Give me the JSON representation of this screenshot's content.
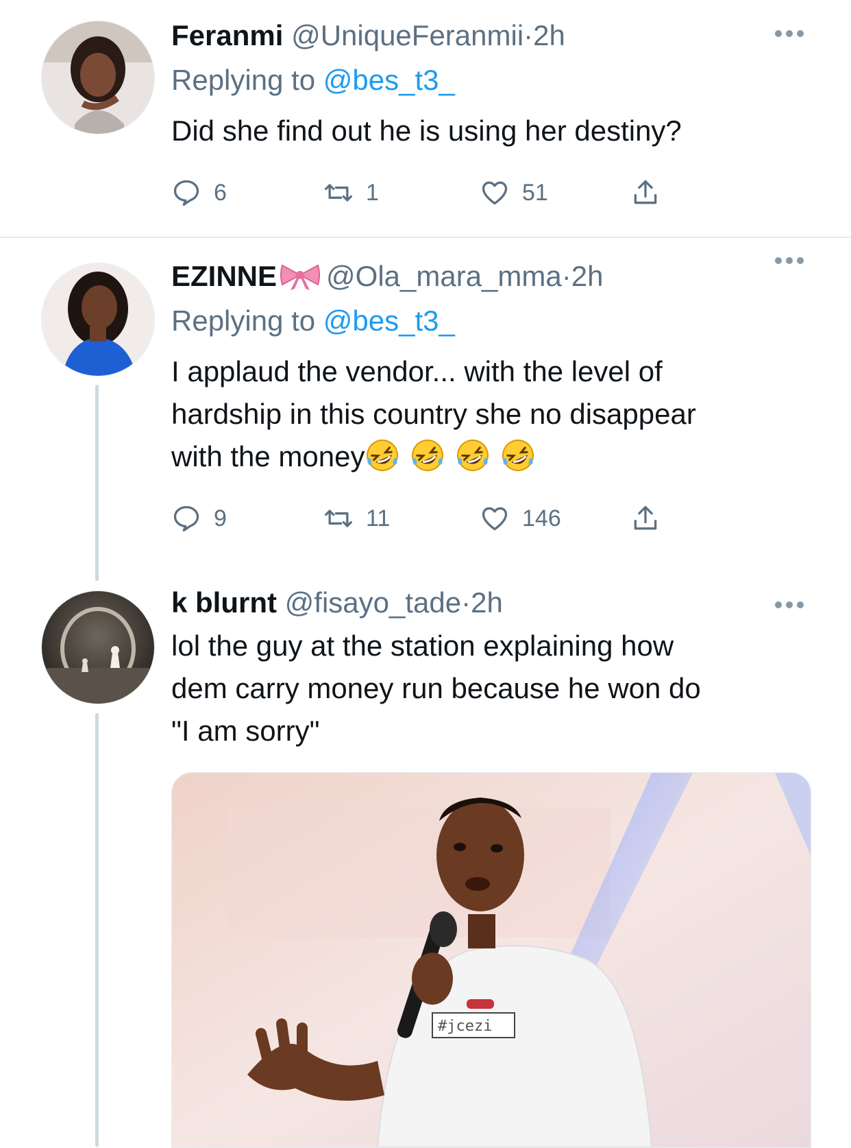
{
  "colors": {
    "link": "#1d9bf0",
    "secondary_text": "#5b7083",
    "primary_text": "#0f1419",
    "divider": "#e6ecf0",
    "thread_line": "#cfd9de"
  },
  "icons": {
    "reply": "speech-bubble",
    "retweet": "retweet-arrows",
    "like": "heart-outline",
    "share": "share-up-arrow",
    "more": "three-dots",
    "bow": "pink-ribbon-emoji",
    "laugh": "rolling-on-floor-laughing-emoji"
  },
  "tweets": [
    {
      "name": "Feranmi",
      "handle": "@UniqueFeranmii",
      "separator": "·",
      "time": "2h",
      "replying_prefix": "Replying to",
      "replying_to": "@bes_t3_",
      "text": "Did she find out he is using her destiny?",
      "replies": "6",
      "retweets": "1",
      "likes": "51"
    },
    {
      "name": "EZINNE",
      "handle": "@Ola_mara_mma",
      "separator": "·",
      "time": "2h",
      "replying_prefix": "Replying to",
      "replying_to": "@bes_t3_",
      "text_line1": "I applaud the vendor... with the level of",
      "text_line2": "hardship in this country she no disappear",
      "text_line3": "with the money",
      "emoji_count": 4,
      "replies": "9",
      "retweets": "11",
      "likes": "146"
    },
    {
      "name": "k blurnt",
      "handle": "@fisayo_tade",
      "separator": "·",
      "time": "2h",
      "text_line1": "lol the guy at the station explaining how",
      "text_line2": "dem carry money run because he won do",
      "text_line3": "\"I am sorry\"",
      "media_caption_fragment": "#jcezi"
    }
  ]
}
